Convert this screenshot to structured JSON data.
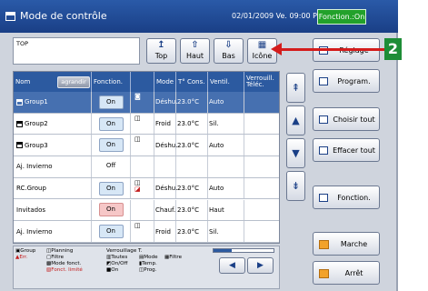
{
  "window": {
    "title": "Mode de contrôle",
    "datetime": "02/01/2009 Ve. 09:00 PM",
    "status_button": "Fonction.:On"
  },
  "path": {
    "value": "TOP"
  },
  "nav_buttons": {
    "top": "Top",
    "haut": "Haut",
    "bas": "Bas",
    "icone": "Icône"
  },
  "table": {
    "headers": {
      "nom": "Nom",
      "agrandir": "agrandir",
      "fonction": "Fonction.",
      "mode": "Mode",
      "temp": "T° Cons.",
      "ventil": "Ventil.",
      "verrou": "Verrouill. Téléc."
    },
    "rows": [
      {
        "name": "Group1",
        "fonction": "On",
        "mode": "Déshu.",
        "temp": "23.0°C",
        "ventil": "Auto"
      },
      {
        "name": "Group2",
        "fonction": "On",
        "mode": "Froid",
        "temp": "23.0°C",
        "ventil": "Sil."
      },
      {
        "name": "Group3",
        "fonction": "On",
        "mode": "Déshu.",
        "temp": "23.0°C",
        "ventil": "Auto"
      },
      {
        "name": "Aj. Invierno",
        "fonction": "Off",
        "mode": "",
        "temp": "",
        "ventil": ""
      },
      {
        "name": "RC.Group",
        "fonction": "On",
        "mode": "Déshu.",
        "temp": "23.0°C",
        "ventil": "Auto"
      },
      {
        "name": "Invitados",
        "fonction": "On",
        "mode": "Chauf.",
        "temp": "23.0°C",
        "ventil": "Haut"
      },
      {
        "name": "Aj. Invierno",
        "fonction": "On",
        "mode": "Froid",
        "temp": "23.0°C",
        "ventil": "Sil."
      }
    ],
    "horizontal_scroll_fraction": 0.3
  },
  "legend": {
    "group": "Group",
    "planning": "Planning",
    "err": "Err.",
    "filtre": "Filtre",
    "mode_fonct": "Mode fonct.",
    "fonct_limite": "Fonct. limité",
    "verrouillage_title": "Verrouillage T.",
    "toutes": "Toutes",
    "mode": "Mode",
    "filtre2": "Filtre",
    "onoff": "On/Off",
    "temp": "Temp.",
    "on": "On",
    "prog": "Prog."
  },
  "side_buttons": {
    "reglage": "Réglage",
    "program": "Program.",
    "choisir_tout": "Choisir tout",
    "effacer_tout": "Effacer tout",
    "fonction": "Fonction.",
    "marche": "Marche",
    "arret": "Arrêt"
  },
  "callout": {
    "number": "2"
  },
  "colors": {
    "titlebar": "#1a3f86",
    "header": "#2c5aa0",
    "status_green": "#22a12b",
    "callout_red": "#d41c1c",
    "callout_green": "#1e8d37",
    "warm_on": "#f6c7c7"
  }
}
